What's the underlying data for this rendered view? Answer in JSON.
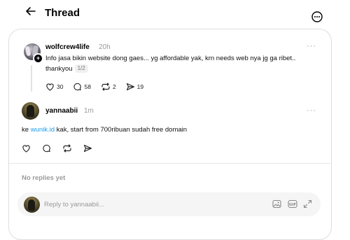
{
  "header": {
    "title": "Thread"
  },
  "post": {
    "username": "wolfcrew4life",
    "time": "20h",
    "text": "Info jasa bikin website dong gaes... yg affordable yak, krn needs web nya jg ga ribet.. thankyou",
    "page_indicator": "1/2",
    "likes": "30",
    "comments": "58",
    "reposts": "2",
    "shares": "19"
  },
  "reply": {
    "username": "yannaabii",
    "time": "1m",
    "text_before": "ke ",
    "link_text": "wunik.id",
    "text_after": " kak, start from 700ribuan sudah free domain"
  },
  "replies_section": {
    "empty_label": "No replies yet"
  },
  "composer": {
    "placeholder": "Reply to yannaabii..."
  },
  "colors": {
    "link": "#1d9bf0",
    "muted": "#9a9a9a",
    "border": "#dedede"
  },
  "icons": {
    "back": "arrow-left-icon",
    "more": "more-circle-icon",
    "like": "heart-icon",
    "comment": "comment-icon",
    "repost": "repost-icon",
    "share": "send-icon",
    "image": "image-icon",
    "gif": "gif-icon",
    "expand": "expand-icon"
  }
}
